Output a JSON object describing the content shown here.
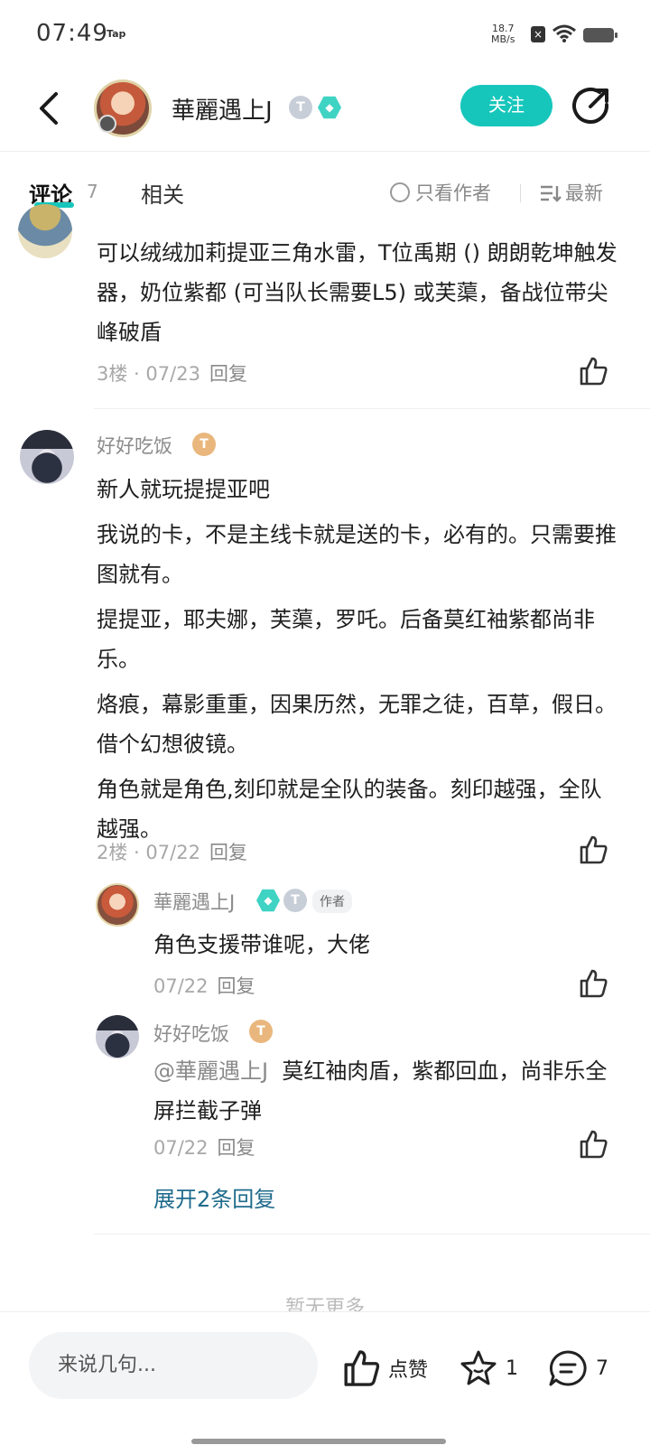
{
  "status_bar": {
    "time": "07:49",
    "carrier_tag": "Tap",
    "net_speed_value": "18.7",
    "net_speed_unit": "MB/s"
  },
  "header": {
    "user_name": "華麗遇上J",
    "follow_label": "关注"
  },
  "tabs": {
    "comments_label": "评论",
    "comments_count": "7",
    "related_label": "相关",
    "author_only_label": "只看作者",
    "sort_label": "最新"
  },
  "comments": [
    {
      "text": "可以绒绒加莉提亚三角水雷，T位禹期 () 朗朗乾坤触发器，奶位紫都 (可当队长需要L5) 或芙蕖，备战位带尖峰破盾",
      "floor": "3楼",
      "date": "07/23",
      "reply_label": "回复"
    },
    {
      "user_name": "好好吃饭",
      "text_lines": [
        "新人就玩提提亚吧",
        "我说的卡，不是主线卡就是送的卡，必有的。只需要推图就有。",
        "提提亚，耶夫娜，芙蕖，罗吒。后备莫红袖紫都尚非乐。",
        "烙痕，幕影重重，因果历然，无罪之徒，百草，假日。借个幻想彼镜。",
        "角色就是角色,刻印就是全队的装备。刻印越强，全队越强。"
      ],
      "floor": "2楼",
      "date": "07/22",
      "reply_label": "回复",
      "replies": [
        {
          "user_name": "華麗遇上J",
          "author_tag": "作者",
          "text": "角色支援带谁呢，大佬",
          "date": "07/22",
          "reply_label": "回复"
        },
        {
          "user_name": "好好吃饭",
          "mention": "@華麗遇上J",
          "text": "莫红袖肉盾，紫都回血，尚非乐全屏拦截子弹",
          "date": "07/22",
          "reply_label": "回复"
        }
      ],
      "expand_label": "展开2条回复"
    }
  ],
  "no_more_label": "暂无更多",
  "bottom_bar": {
    "input_placeholder": "来说几句...",
    "like_label": "点赞",
    "favorite_count": "1",
    "comment_count": "7"
  },
  "badges": {
    "t2": "T",
    "t6": "T",
    "t2_level": "2",
    "t6_level": "6"
  },
  "colors": {
    "accent": "#16c6bb",
    "link": "#1f6b8c",
    "muted": "#a8a8a8"
  }
}
